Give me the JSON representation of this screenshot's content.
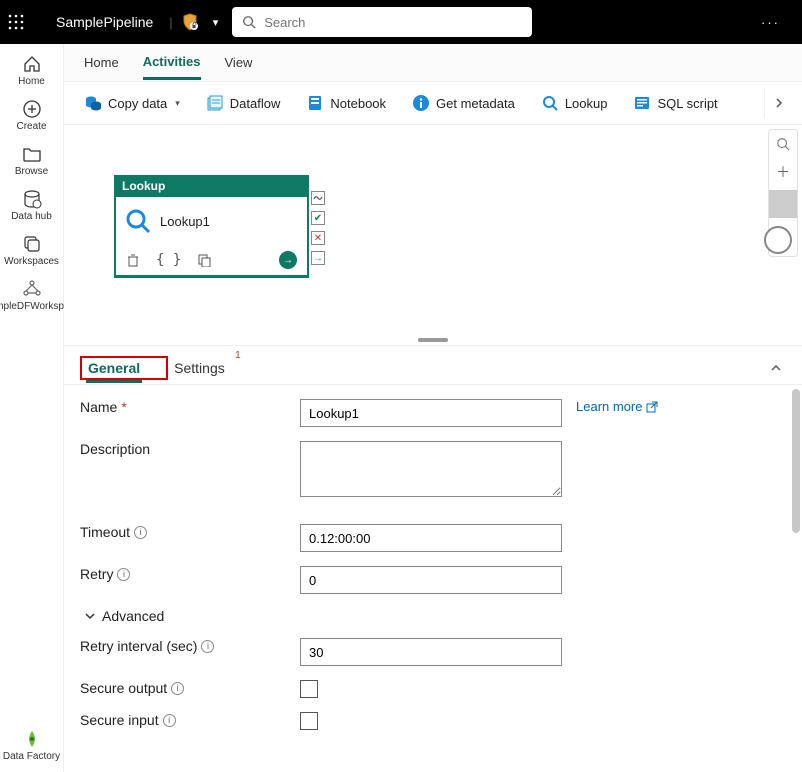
{
  "topbar": {
    "project": "SamplePipeline",
    "search_placeholder": "Search",
    "more": "···"
  },
  "leftrail": {
    "items": [
      {
        "label": "Home",
        "icon": "home"
      },
      {
        "label": "Create",
        "icon": "plus-circle"
      },
      {
        "label": "Browse",
        "icon": "folder"
      },
      {
        "label": "Data hub",
        "icon": "db"
      },
      {
        "label": "Workspaces",
        "icon": "stack"
      },
      {
        "label": "SampleDFWorkspace",
        "icon": "graph"
      }
    ],
    "bottom": {
      "label": "Data Factory",
      "icon": "df"
    }
  },
  "navtabs": [
    "Home",
    "Activities",
    "View"
  ],
  "navtabs_active": 1,
  "toolbar": [
    {
      "label": "Copy data",
      "icon": "copydata",
      "has_chevron": true
    },
    {
      "label": "Dataflow",
      "icon": "dataflow"
    },
    {
      "label": "Notebook",
      "icon": "notebook"
    },
    {
      "label": "Get metadata",
      "icon": "info"
    },
    {
      "label": "Lookup",
      "icon": "lookup"
    },
    {
      "label": "SQL script",
      "icon": "sql"
    }
  ],
  "canvas": {
    "node": {
      "type_label": "Lookup",
      "name": "Lookup1"
    },
    "zoom": {
      "tools": [
        "search",
        "plus",
        "minus"
      ]
    }
  },
  "prop_tabs": {
    "tabs": [
      "General",
      "Settings"
    ],
    "active": 0,
    "settings_badge": "1"
  },
  "form": {
    "learn_more": "Learn more",
    "name_label": "Name",
    "name_value": "Lookup1",
    "description_label": "Description",
    "description_value": "",
    "timeout_label": "Timeout",
    "timeout_value": "0.12:00:00",
    "retry_label": "Retry",
    "retry_value": "0",
    "advanced_label": "Advanced",
    "retry_interval_label": "Retry interval (sec)",
    "retry_interval_value": "30",
    "secure_output_label": "Secure output",
    "secure_output_checked": false,
    "secure_input_label": "Secure input",
    "secure_input_checked": false
  }
}
